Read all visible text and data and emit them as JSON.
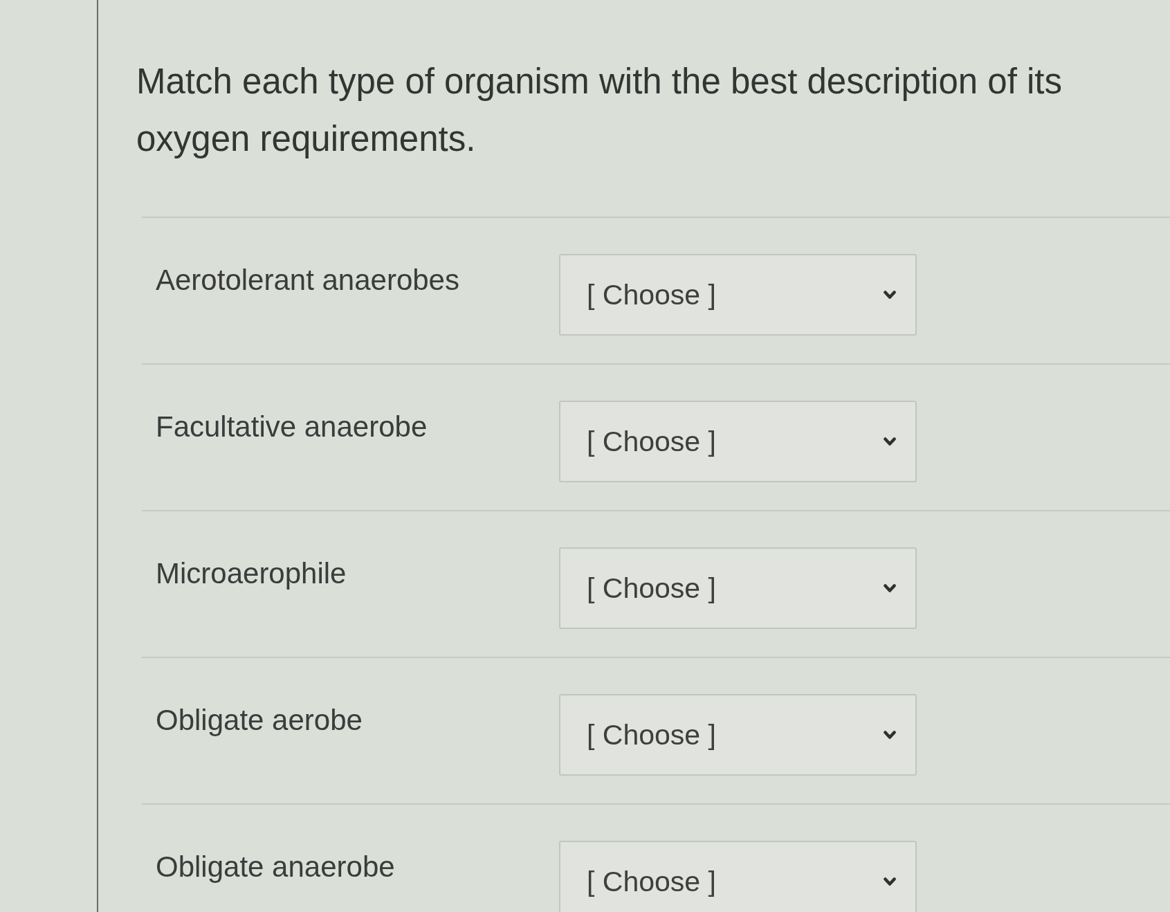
{
  "question": {
    "prompt": "Match each type of organism with the best description of its oxygen requirements."
  },
  "matches": [
    {
      "label": "Aerotolerant anaerobes",
      "dropdown": {
        "value": "[ Choose ]"
      }
    },
    {
      "label": "Facultative anaerobe",
      "dropdown": {
        "value": "[ Choose ]"
      }
    },
    {
      "label": "Microaerophile",
      "dropdown": {
        "value": "[ Choose ]"
      }
    },
    {
      "label": "Obligate aerobe",
      "dropdown": {
        "value": "[ Choose ]"
      }
    },
    {
      "label": "Obligate anaerobe",
      "dropdown": {
        "value": "[ Choose ]"
      }
    }
  ]
}
